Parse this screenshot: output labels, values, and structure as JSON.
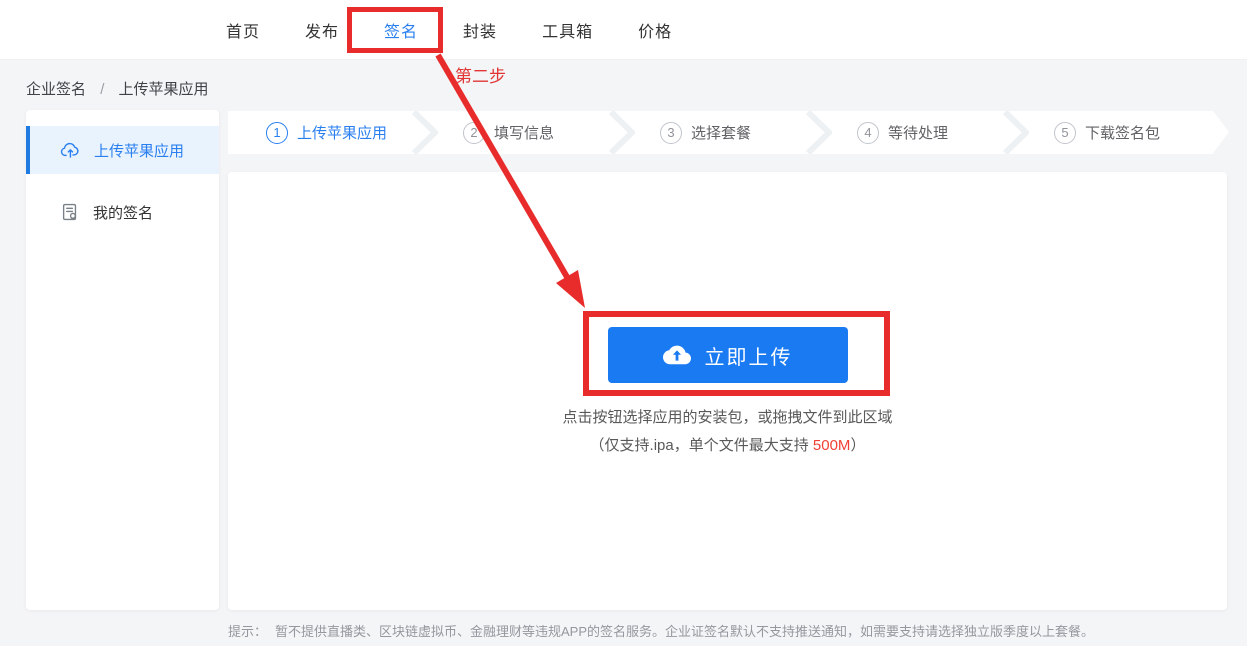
{
  "colors": {
    "accent_blue": "#1a7af2",
    "sidebar_active_bg": "#e8f3fd",
    "annotation_red": "#e82c2c",
    "size_limit_red": "#f04134",
    "page_bg": "#f4f5f7"
  },
  "header": {
    "tabs": [
      {
        "label": "首页"
      },
      {
        "label": "发布"
      },
      {
        "label": "签名"
      },
      {
        "label": "封装"
      },
      {
        "label": "工具箱"
      },
      {
        "label": "价格"
      }
    ],
    "active_tab": "签名"
  },
  "breadcrumb": {
    "items": [
      "企业签名",
      "上传苹果应用"
    ],
    "separator": "/"
  },
  "sidebar": {
    "items": [
      {
        "label": "上传苹果应用",
        "icon": "cloud-upload-icon",
        "active": true
      },
      {
        "label": "我的签名",
        "icon": "signature-doc-icon",
        "active": false
      }
    ]
  },
  "steps": [
    {
      "num": "1",
      "label": "上传苹果应用",
      "active": true
    },
    {
      "num": "2",
      "label": "填写信息",
      "active": false
    },
    {
      "num": "3",
      "label": "选择套餐",
      "active": false
    },
    {
      "num": "4",
      "label": "等待处理",
      "active": false
    },
    {
      "num": "5",
      "label": "下载签名包",
      "active": false
    }
  ],
  "main": {
    "upload": {
      "button_label": "立即上传",
      "button_icon": "cloud-upload-icon",
      "instruction_line1": "点击按钮选择应用的安装包，或拖拽文件到此区域",
      "instruction_line2_prefix": "（仅支持.ipa，单个文件最大支持 ",
      "instruction_line2_highlight": "500M",
      "instruction_line2_suffix": "）"
    }
  },
  "footer": {
    "prefix": "提示：",
    "text": "暂不提供直播类、区块链虚拟币、金融理财等违规APP的签名服务。企业证签名默认不支持推送通知，如需要支持请选择独立版季度以上套餐。"
  },
  "annotations": {
    "step_label": "第二步"
  }
}
